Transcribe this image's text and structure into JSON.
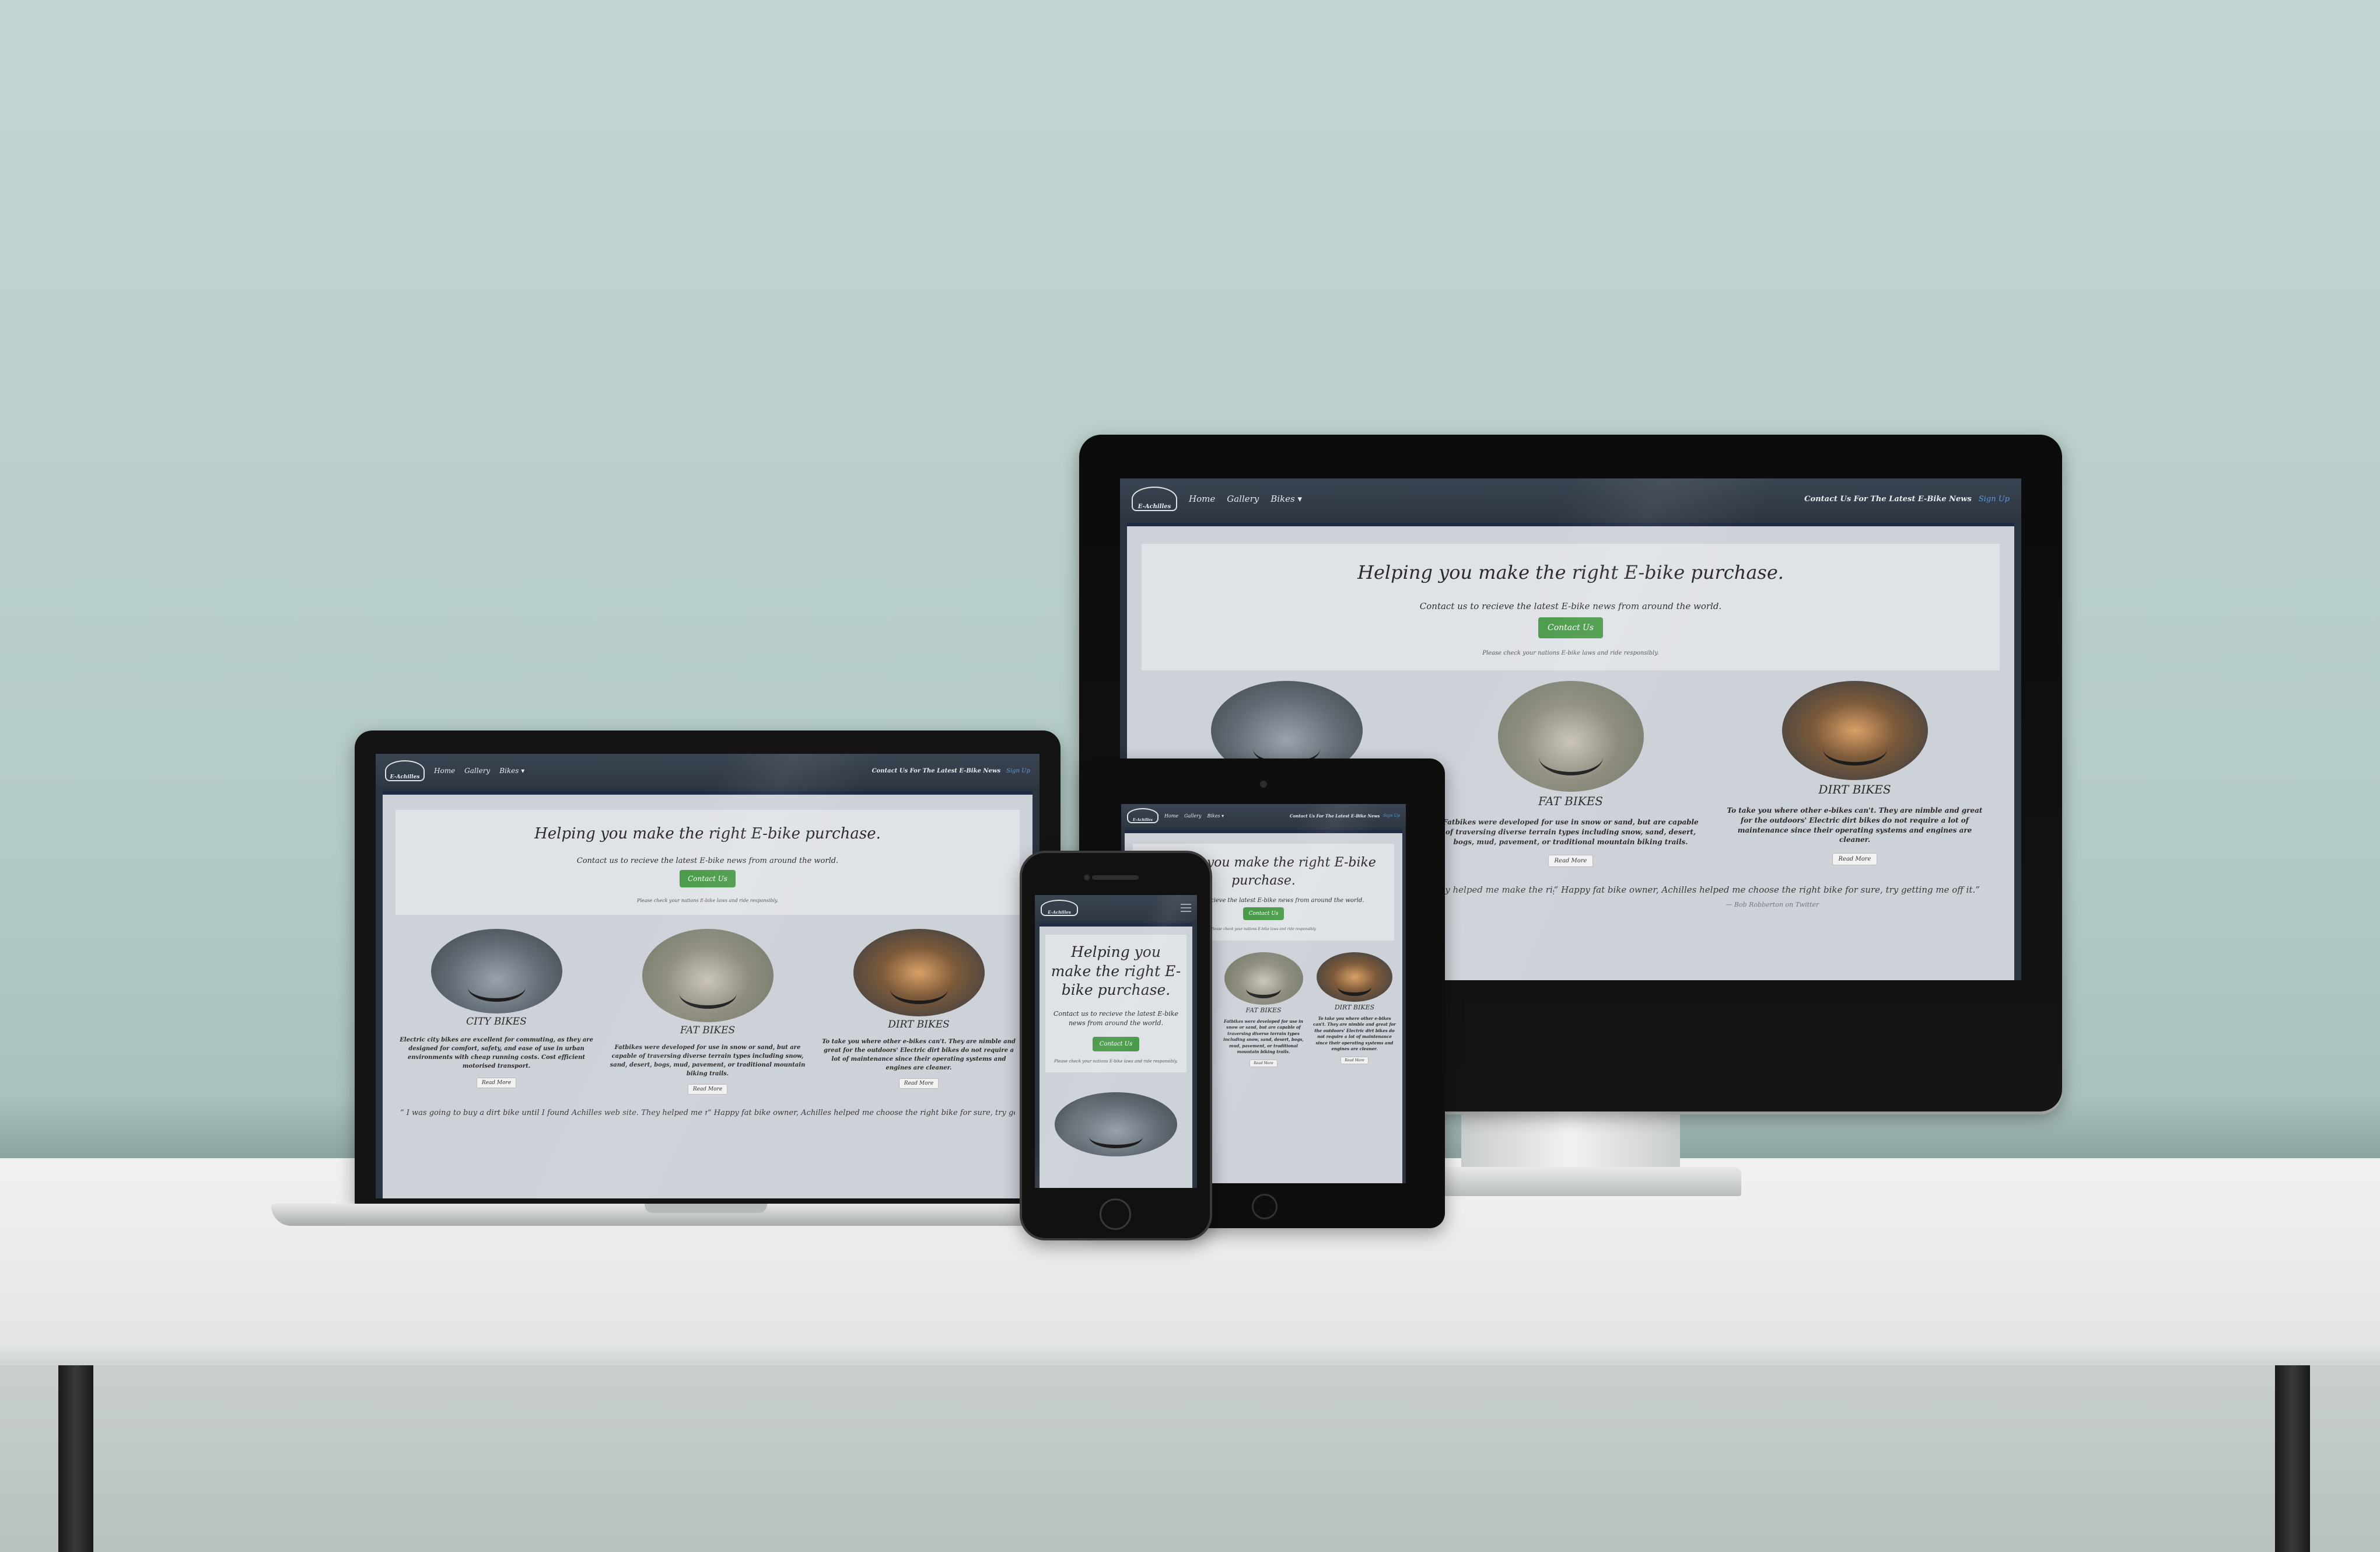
{
  "site": {
    "brand": "E-Achilles",
    "nav": {
      "home": "Home",
      "gallery": "Gallery",
      "bikes": "Bikes ▾",
      "tagline": "Contact Us For The Latest E-Bike News",
      "signup": "Sign Up"
    },
    "hero": {
      "title": "Helping you make the right E-bike purchase.",
      "subtitle": "Contact us to recieve the latest E-bike news from around the world.",
      "cta": "Contact Us",
      "note": "Please check your nations E-bike laws and ride responsibly."
    },
    "cards": [
      {
        "title": "CITY BIKES",
        "text": "Electric city bikes are excellent for commuting, as they are designed for comfort, safety, and ease of use in urban environments with cheap running costs. Cost efficient motorised transport.",
        "button": "Read More"
      },
      {
        "title": "FAT BIKES",
        "text": "Fatbikes were developed for use in snow or sand, but are capable of traversing diverse terrain types including snow, sand, desert, bogs, mud, pavement, or traditional mountain biking trails.",
        "button": "Read More"
      },
      {
        "title": "DIRT BIKES",
        "text": "To take you where other e-bikes can't. They are nimble and great for the outdoors' Electric dirt bikes do not require a lot of maintenance since their operating systems and engines are cleaner.",
        "button": "Read More"
      }
    ],
    "quotes": [
      {
        "text": "“ I was going to buy a dirt bike until I found Achilles web site. They helped me make the right"
      },
      {
        "text": "“ Happy fat bike owner, Achilles helped me choose the right bike for sure, try getting me off it.”",
        "author": "— Bob Robberton on Twitter"
      }
    ]
  }
}
